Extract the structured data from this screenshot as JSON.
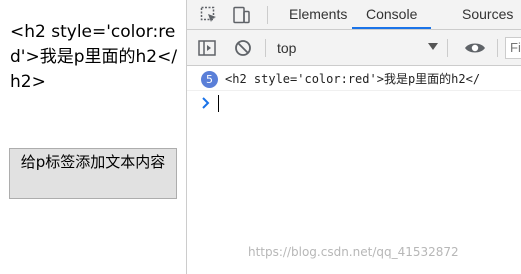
{
  "page": {
    "paragraph_text": "<h2 style='color:red'>我是p里面的h2</h2>",
    "button_label": "给p标签添加文本内容"
  },
  "devtools": {
    "tabs": [
      "Elements",
      "Console",
      "Sources"
    ],
    "active_tab": "Console",
    "context": "top",
    "filter_placeholder": "Fi",
    "log": {
      "repeat_count": "5",
      "text": "<h2 style='color:red'>我是p里面的h2</"
    }
  },
  "watermark": "https://blog.csdn.net/qq_41532872",
  "colors": {
    "accent": "#1a73e8",
    "badge": "#5a7fd8",
    "toolbar_bg": "#f3f3f3",
    "prompt": "#1a73e8"
  }
}
